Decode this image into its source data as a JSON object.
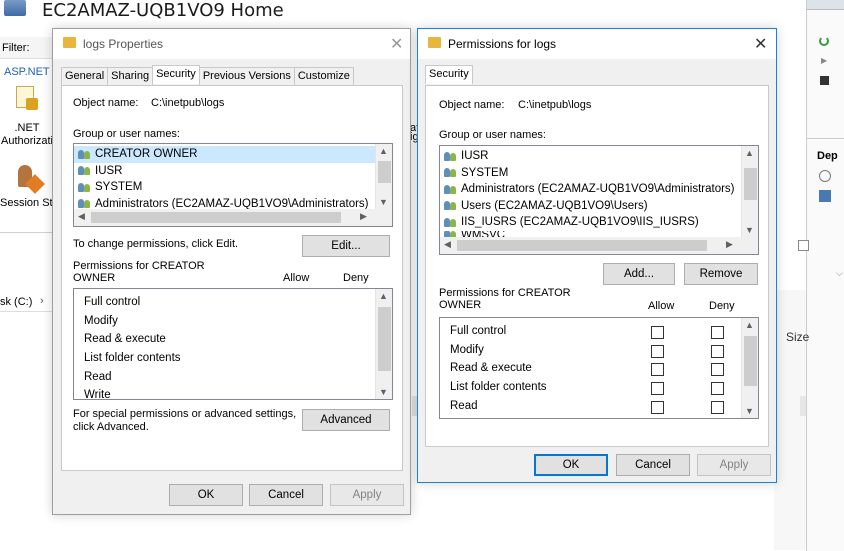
{
  "background": {
    "title": "EC2AMAZ-UQB1VO9 Home",
    "filter_label": "Filter:",
    "asp_net_label": "ASP.NET",
    "icons": [
      {
        "label": ".NET Authorizati",
        "icon": "authorization-icon"
      },
      {
        "label": "Session Sta",
        "icon": "session-state-icon"
      }
    ],
    "breadcrumb": "sk (C:)",
    "breadcrumb_sep": "›",
    "size_col": "Size",
    "right_partial_a": "at",
    "right_partial_b": "ig",
    "right_dep": "Dep"
  },
  "props": {
    "title": "logs Properties",
    "close": "✕",
    "tabs": [
      "General",
      "Sharing",
      "Security",
      "Previous Versions",
      "Customize"
    ],
    "selected_tab": "Security",
    "object_name_label": "Object name:",
    "object_name_value": "C:\\inetpub\\logs",
    "group_label": "Group or user names:",
    "users": [
      "CREATOR OWNER",
      "IUSR",
      "SYSTEM",
      "Administrators (EC2AMAZ-UQB1VO9\\Administrators)"
    ],
    "change_text": "To change permissions, click Edit.",
    "edit_button": "Edit...",
    "perm_for_1": "Permissions for CREATOR",
    "perm_for_2": "OWNER",
    "allow": "Allow",
    "deny": "Deny",
    "permissions": [
      "Full control",
      "Modify",
      "Read & execute",
      "List folder contents",
      "Read",
      "Write"
    ],
    "special_1": "For special permissions or advanced settings,",
    "special_2": "click Advanced.",
    "advanced_button": "Advanced",
    "ok": "OK",
    "cancel": "Cancel",
    "apply": "Apply"
  },
  "perms": {
    "title": "Permissions for logs",
    "close": "✕",
    "tab": "Security",
    "object_name_label": "Object name:",
    "object_name_value": "C:\\inetpub\\logs",
    "group_label": "Group or user names:",
    "users": [
      "IUSR",
      "SYSTEM",
      "Administrators (EC2AMAZ-UQB1VO9\\Administrators)",
      "Users (EC2AMAZ-UQB1VO9\\Users)",
      "IIS_IUSRS (EC2AMAZ-UQB1VO9\\IIS_IUSRS)",
      "WMSVC"
    ],
    "add_button": "Add...",
    "remove_button": "Remove",
    "perm_for_1": "Permissions for CREATOR",
    "perm_for_2": "OWNER",
    "allow": "Allow",
    "deny": "Deny",
    "permissions": [
      "Full control",
      "Modify",
      "Read & execute",
      "List folder contents",
      "Read"
    ],
    "ok": "OK",
    "cancel": "Cancel",
    "apply": "Apply"
  }
}
